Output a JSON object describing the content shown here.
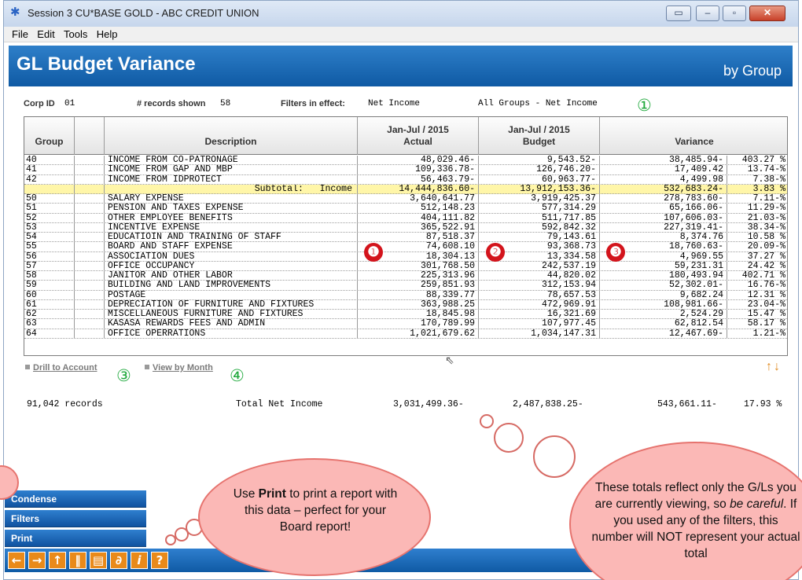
{
  "window": {
    "title": "Session 3 CU*BASE GOLD - ABC CREDIT UNION"
  },
  "menu": [
    "File",
    "Edit",
    "Tools",
    "Help"
  ],
  "header": {
    "title": "GL Budget Variance",
    "subtitle": "by Group"
  },
  "info": {
    "corp_label": "Corp ID",
    "corp_value": "01",
    "records_label": "# records shown",
    "records_value": "58",
    "filters_label": "Filters in effect:",
    "filter1": "Net Income",
    "filter2": "All Groups - Net Income"
  },
  "table": {
    "headers": {
      "group": "Group",
      "description": "Description",
      "actual_l1": "Jan-Jul / 2015",
      "actual_l2": "Actual",
      "budget_l1": "Jan-Jul / 2015",
      "budget_l2": "Budget",
      "variance": "Variance"
    },
    "rows": [
      {
        "group": "40",
        "desc": "INCOME FROM CO-PATRONAGE",
        "actual": "48,029.46-",
        "budget": "9,543.52-",
        "variance": "38,485.94-",
        "pct": "403.27 %",
        "subtotal": false
      },
      {
        "group": "41",
        "desc": "INCOME FROM GAP AND MBP",
        "actual": "109,336.78-",
        "budget": "126,746.20-",
        "variance": "17,409.42",
        "pct": "13.74-%",
        "subtotal": false
      },
      {
        "group": "42",
        "desc": "INCOME FROM IDPROTECT",
        "actual": "56,463.79-",
        "budget": "60,963.77-",
        "variance": "4,499.98",
        "pct": "7.38-%",
        "subtotal": false
      },
      {
        "group": "",
        "desc": "Subtotal:   Income",
        "actual": "14,444,836.60-",
        "budget": "13,912,153.36-",
        "variance": "532,683.24-",
        "pct": "3.83 %",
        "subtotal": true
      },
      {
        "group": "50",
        "desc": "SALARY EXPENSE",
        "actual": "3,640,641.77",
        "budget": "3,919,425.37",
        "variance": "278,783.60-",
        "pct": "7.11-%",
        "subtotal": false
      },
      {
        "group": "51",
        "desc": "PENSION AND TAXES EXPENSE",
        "actual": "512,148.23",
        "budget": "577,314.29",
        "variance": "65,166.06-",
        "pct": "11.29-%",
        "subtotal": false
      },
      {
        "group": "52",
        "desc": "OTHER EMPLOYEE BENEFITS",
        "actual": "404,111.82",
        "budget": "511,717.85",
        "variance": "107,606.03-",
        "pct": "21.03-%",
        "subtotal": false
      },
      {
        "group": "53",
        "desc": "INCENTIVE EXPENSE",
        "actual": "365,522.91",
        "budget": "592,842.32",
        "variance": "227,319.41-",
        "pct": "38.34-%",
        "subtotal": false
      },
      {
        "group": "54",
        "desc": "EDUCATIOIN AND TRAINING OF STAFF",
        "actual": "87,518.37",
        "budget": "79,143.61",
        "variance": "8,374.76",
        "pct": "10.58 %",
        "subtotal": false
      },
      {
        "group": "55",
        "desc": "BOARD AND STAFF EXPENSE",
        "actual": "74,608.10",
        "budget": "93,368.73",
        "variance": "18,760.63-",
        "pct": "20.09-%",
        "subtotal": false
      },
      {
        "group": "56",
        "desc": "ASSOCIATION DUES",
        "actual": "18,304.13",
        "budget": "13,334.58",
        "variance": "4,969.55",
        "pct": "37.27 %",
        "subtotal": false
      },
      {
        "group": "57",
        "desc": "OFFICE OCCUPANCY",
        "actual": "301,768.50",
        "budget": "242,537.19",
        "variance": "59,231.31",
        "pct": "24.42 %",
        "subtotal": false
      },
      {
        "group": "58",
        "desc": "JANITOR AND OTHER LABOR",
        "actual": "225,313.96",
        "budget": "44,820.02",
        "variance": "180,493.94",
        "pct": "402.71 %",
        "subtotal": false
      },
      {
        "group": "59",
        "desc": "BUILDING AND LAND IMPROVEMENTS",
        "actual": "259,851.93",
        "budget": "312,153.94",
        "variance": "52,302.01-",
        "pct": "16.76-%",
        "subtotal": false
      },
      {
        "group": "60",
        "desc": "POSTAGE",
        "actual": "88,339.77",
        "budget": "78,657.53",
        "variance": "9,682.24",
        "pct": "12.31 %",
        "subtotal": false
      },
      {
        "group": "61",
        "desc": "DEPRECIATION OF FURNITURE AND FIXTURES",
        "actual": "363,988.25",
        "budget": "472,969.91",
        "variance": "108,981.66-",
        "pct": "23.04-%",
        "subtotal": false
      },
      {
        "group": "62",
        "desc": "MISCELLANEOUS FURNITURE AND FIXTURES",
        "actual": "18,845.98",
        "budget": "16,321.69",
        "variance": "2,524.29",
        "pct": "15.47 %",
        "subtotal": false
      },
      {
        "group": "63",
        "desc": "KASASA REWARDS FEES AND ADMIN",
        "actual": "170,789.99",
        "budget": "107,977.45",
        "variance": "62,812.54",
        "pct": "58.17 %",
        "subtotal": false
      },
      {
        "group": "64",
        "desc": "OFFICE OPERRATIONS",
        "actual": "1,021,679.62",
        "budget": "1,034,147.31",
        "variance": "12,467.69-",
        "pct": "1.21-%",
        "subtotal": false
      }
    ]
  },
  "actions": {
    "drill": "Drill to Account",
    "view": "View by Month"
  },
  "totals": {
    "records": "91,042 records",
    "label": "Total Net Income",
    "actual": "3,031,499.36-",
    "budget": "2,487,838.25-",
    "variance": "543,661.11-",
    "pct": "17.93 %"
  },
  "side_buttons": [
    "Condense",
    "Filters",
    "Print"
  ],
  "annotations": {
    "green1": "①",
    "green3": "③",
    "green4": "④",
    "red1": "❶",
    "red2": "❷",
    "red3": "❸",
    "callout_left_pre": "Use ",
    "callout_left_bold": "Print",
    "callout_left_post": " to print a report with this data – perfect for your Board report!",
    "callout_right_a": "These totals reflect only the G/Ls you are currently viewing, so ",
    "callout_right_em": "be careful",
    "callout_right_b": ". If you used any of the filters, this number will NOT represent your actual total"
  },
  "colors": {
    "header_blue": "#1a6cb8",
    "subtotal_yellow": "#fff6a8",
    "callout_pink": "#fbb8b6",
    "accent_orange": "#e98a1a",
    "annotation_green": "#1ea83b",
    "annotation_red": "#d3141c"
  }
}
